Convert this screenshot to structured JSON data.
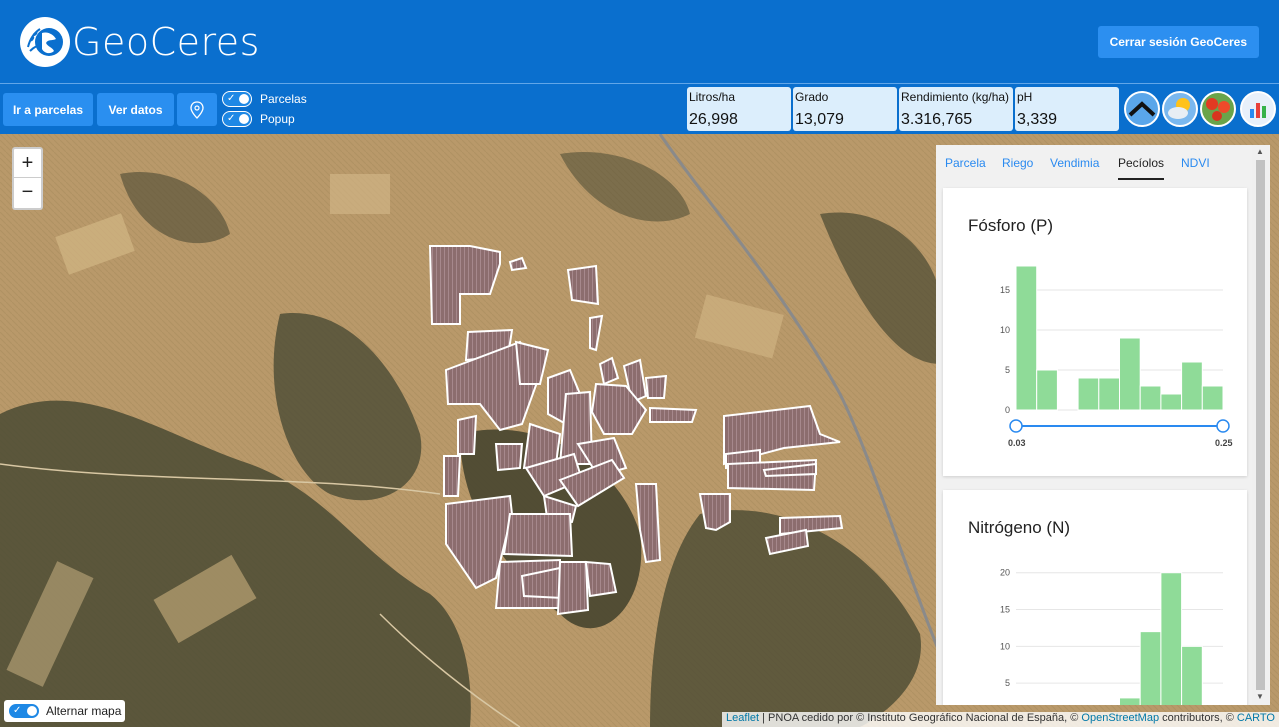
{
  "app": {
    "brand": "GeoCeres",
    "logout_label": "Cerrar sesión GeoCeres"
  },
  "toolbar": {
    "go_parcels_label": "Ir a parcelas",
    "view_data_label": "Ver datos",
    "location_icon": "map-pin-icon",
    "toggles": [
      {
        "label": "Parcelas",
        "on": true
      },
      {
        "label": "Popup",
        "on": true
      }
    ]
  },
  "stats": [
    {
      "label": "Litros/ha",
      "value": "26,998"
    },
    {
      "label": "Grado",
      "value": "13,079"
    },
    {
      "label": "Rendimiento (kg/ha)",
      "value": "3.316,765"
    },
    {
      "label": "pH",
      "value": "3,339"
    }
  ],
  "layer_icons": [
    "terrain-icon",
    "weather-icon",
    "poppy-field-icon",
    "bar-chart-icon"
  ],
  "map": {
    "zoom_in": "+",
    "zoom_out": "−",
    "toggle_label": "Alternar mapa",
    "attribution": {
      "leaflet": "Leaflet",
      "sep1": " | PNOA cedido por © Instituto Geográfico Nacional de España, © ",
      "osm": "OpenStreetMap",
      "sep2": " contributors, © ",
      "carto": "CARTO"
    }
  },
  "panel": {
    "tabs": [
      {
        "label": "Parcela",
        "active": false
      },
      {
        "label": "Riego",
        "active": false
      },
      {
        "label": "Vendimia",
        "active": false
      },
      {
        "label": "Pecíolos",
        "active": true
      },
      {
        "label": "NDVI",
        "active": false
      }
    ],
    "colors": {
      "bar": "#8fdb98",
      "bar_stroke": "#ffffff",
      "slider": "#2a8af0"
    }
  },
  "chart_data": [
    {
      "type": "bar",
      "title": "Fósforo (P)",
      "values": [
        18,
        5,
        0,
        4,
        4,
        9,
        3,
        2,
        6,
        3
      ],
      "yticks": [
        0,
        5,
        10,
        15
      ],
      "ylim": [
        0,
        20
      ],
      "range_min": "0.03",
      "range_max": "0.25"
    },
    {
      "type": "bar",
      "title": "Nitrógeno (N)",
      "values": [
        1,
        0,
        0,
        0,
        0,
        3,
        12,
        20,
        10,
        2
      ],
      "yticks": [
        5,
        10,
        15,
        20
      ],
      "ylim": [
        0,
        22
      ]
    }
  ]
}
